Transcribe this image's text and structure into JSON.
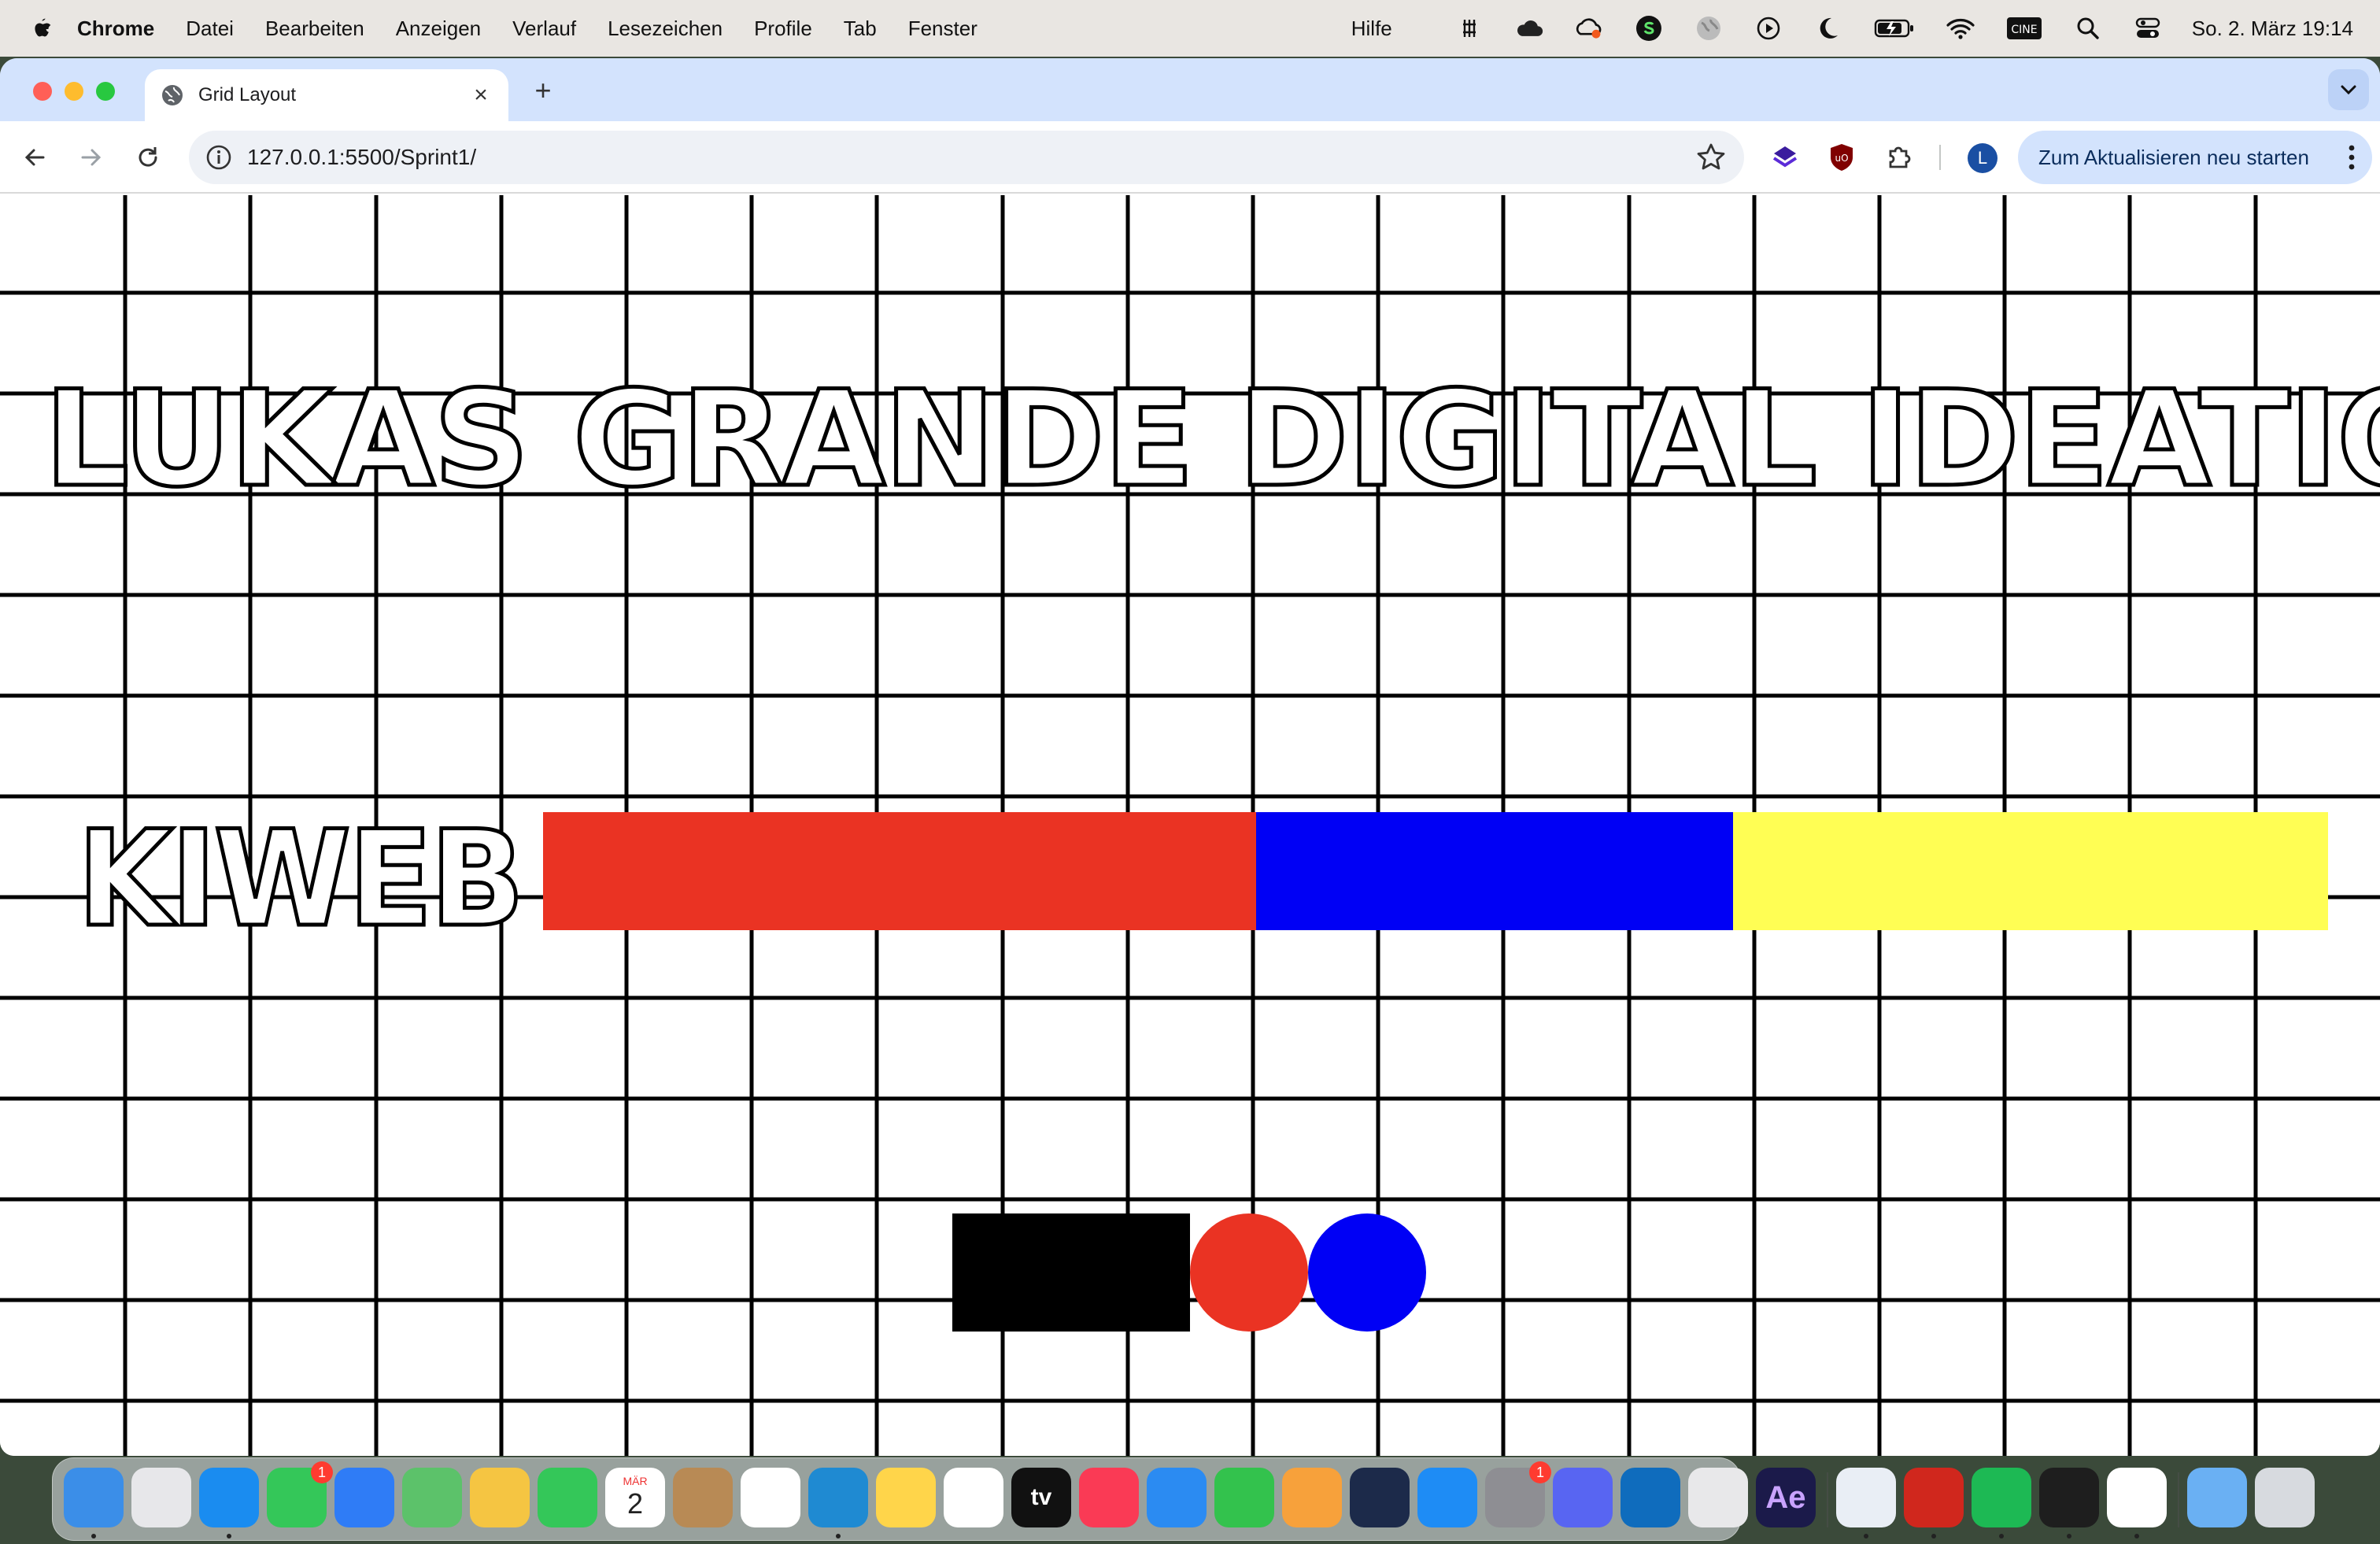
{
  "menubar": {
    "app_name": "Chrome",
    "items": [
      "Datei",
      "Bearbeiten",
      "Anzeigen",
      "Verlauf",
      "Lesezeichen",
      "Profile",
      "Tab",
      "Fenster"
    ],
    "help": "Hilfe",
    "status_icons": [
      "notch-icon",
      "cloud-icon",
      "creative-cloud-icon",
      "skype-icon",
      "globe-icon",
      "play-icon",
      "moon-icon",
      "battery-icon",
      "wifi-icon",
      "cinema-icon",
      "search-icon",
      "control-center-icon"
    ],
    "clock": "So. 2. März  19:14"
  },
  "browser": {
    "tab_title": "Grid Layout",
    "url": "127.0.0.1:5500/Sprint1/",
    "update_button": "Zum Aktualisieren neu starten",
    "avatar_letter": "L",
    "extensions": [
      "layers-extension-icon",
      "ublock-icon",
      "puzzle-icon"
    ]
  },
  "page": {
    "headline": "LUKAS GRANDE DIGITAL IDEATION",
    "subtitle": "KIWEB",
    "colors": {
      "red": "#ea3323",
      "blue": "#0000f5",
      "yellow": "#fffe54",
      "black": "#000000",
      "grid_line": "#000000"
    }
  },
  "dock": {
    "apps": [
      {
        "name": "finder-icon",
        "color": "#3b8ee8",
        "running": true
      },
      {
        "name": "launchpad-icon",
        "color": "#e7e7ea",
        "running": false
      },
      {
        "name": "safari-icon",
        "color": "#1a8cf0",
        "running": true
      },
      {
        "name": "messages-icon",
        "color": "#34c759",
        "running": false,
        "badge": "1"
      },
      {
        "name": "mail-icon",
        "color": "#2f7cf6",
        "running": false
      },
      {
        "name": "maps-icon",
        "color": "#5cc26a",
        "running": false
      },
      {
        "name": "photos-icon",
        "color": "#f5c542",
        "running": false
      },
      {
        "name": "facetime-icon",
        "color": "#34c759",
        "running": false
      },
      {
        "name": "calendar-icon",
        "color": "#ffffff",
        "running": false
      },
      {
        "name": "contacts-icon",
        "color": "#b88a55",
        "running": false
      },
      {
        "name": "reminders-icon",
        "color": "#ffffff",
        "running": false
      },
      {
        "name": "vscode-icon",
        "color": "#1f8ad2",
        "running": true
      },
      {
        "name": "notes-icon",
        "color": "#ffd54a",
        "running": false
      },
      {
        "name": "freeform-icon",
        "color": "#ffffff",
        "running": false
      },
      {
        "name": "apple-tv-icon",
        "color": "#111111",
        "running": false
      },
      {
        "name": "music-icon",
        "color": "#fa3a55",
        "running": false
      },
      {
        "name": "keynote-icon",
        "color": "#2b8bf2",
        "running": false
      },
      {
        "name": "numbers-icon",
        "color": "#33c24d",
        "running": false
      },
      {
        "name": "pages-icon",
        "color": "#f7a13b",
        "running": false
      },
      {
        "name": "cinema4d-icon",
        "color": "#1c2a4a",
        "running": false
      },
      {
        "name": "app-store-icon",
        "color": "#1e8cf5",
        "running": false
      },
      {
        "name": "system-settings-icon",
        "color": "#8e8e93",
        "running": false,
        "badge": "1"
      },
      {
        "name": "discord-icon",
        "color": "#5865f2",
        "running": false
      },
      {
        "name": "outlook-icon",
        "color": "#0f6cbd",
        "running": false
      },
      {
        "name": "iphone-mirroring-icon",
        "color": "#e8e8ea",
        "running": false
      },
      {
        "name": "after-effects-icon",
        "color": "#1b1a4a",
        "running": false
      },
      {
        "name": "chrome-icon",
        "color": "#e9eef5",
        "running": true
      },
      {
        "name": "acrobat-icon",
        "color": "#d0271d",
        "running": true
      },
      {
        "name": "spotify-icon",
        "color": "#1db954",
        "running": true
      },
      {
        "name": "figma-icon",
        "color": "#1e1e1e",
        "running": true
      },
      {
        "name": "slack-icon",
        "color": "#ffffff",
        "running": true
      },
      {
        "name": "downloads-folder-icon",
        "color": "#6ab0f3",
        "running": false
      },
      {
        "name": "trash-icon",
        "color": "#d7dadf",
        "running": false
      }
    ],
    "labels": {
      "calendar_month": "MÄR",
      "calendar_day": "2",
      "tv": "tv",
      "ae": "Ae"
    }
  }
}
